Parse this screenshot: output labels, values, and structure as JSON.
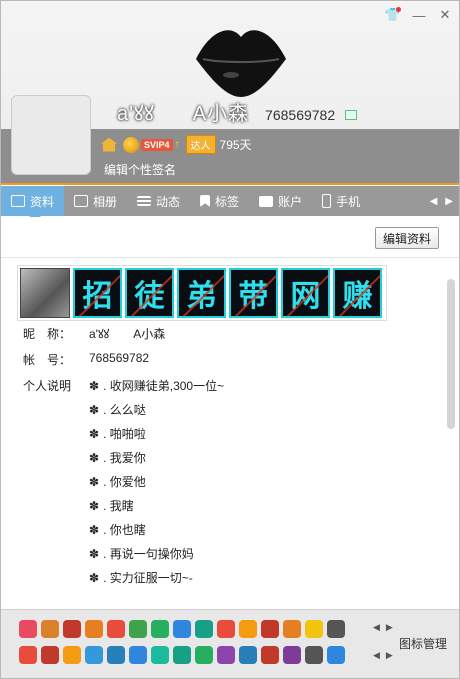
{
  "window": {
    "controls": {
      "skin_icon": "skin-icon",
      "minimize": "—",
      "close": "✕"
    }
  },
  "profile": {
    "nickname_left": "a'ꙋꙋ",
    "nickname_right": "A小森",
    "qq_number": "768569782",
    "svip_level": "SVIP4",
    "svip_arrow": "↑",
    "daren_tag": "达人",
    "daren_days": "795天",
    "signature": "编辑个性签名"
  },
  "tabs": [
    {
      "label": "资料",
      "icon": "profile-card-icon",
      "active": true
    },
    {
      "label": "相册",
      "icon": "photo-album-icon",
      "active": false
    },
    {
      "label": "动态",
      "icon": "feed-list-icon",
      "active": false
    },
    {
      "label": "标签",
      "icon": "tag-bookmark-icon",
      "active": false
    },
    {
      "label": "账户",
      "icon": "wallet-icon",
      "active": false
    },
    {
      "label": "手机",
      "icon": "phone-icon",
      "active": false
    }
  ],
  "tab_nav": {
    "prev": "◀",
    "next": "▶"
  },
  "content": {
    "edit_button": "编辑资料",
    "banner_chars": [
      "招",
      "徒",
      "弟",
      "带",
      "网",
      "赚"
    ],
    "fields": {
      "nickname_label": "昵　称：",
      "nickname_value": "a'ꙋꙋ　　A小森",
      "account_label": "帐　号：",
      "account_value": "768569782",
      "desc_label": "个人说明"
    },
    "description_bullet": "✽",
    "description_lines": [
      ". 收网赚徒弟,300一位~",
      ". 么么哒",
      ". 啪啪啦",
      ". 我爱你",
      ". 你爱他",
      ". 我瞎",
      ". 你也瞎",
      ". 再说一句操你妈",
      ". 实力征服一切~-"
    ]
  },
  "footer": {
    "manage_label": "图标管理",
    "nav_prev": "◀",
    "nav_next": "▶",
    "icons_row1": [
      "#e84a5f",
      "#d9822b",
      "#c0392b",
      "#e67e22",
      "#e74c3c",
      "#3fa34d",
      "#27ae60",
      "#2e86de",
      "#16a085",
      "#e74c3c",
      "#f39c12",
      "#c0392b",
      "#e67e22",
      "#f1c40f",
      "#555555"
    ],
    "icons_row2": [
      "#e74c3c",
      "#c0392b",
      "#f39c12",
      "#3498db",
      "#2980b9",
      "#2e86de",
      "#1abc9c",
      "#16a085",
      "#27ae60",
      "#8e44ad",
      "#2980b9",
      "#c0392b",
      "#7d3c98",
      "#555555",
      "#2e86de"
    ]
  },
  "colors": {
    "tab_active": "#6fb1e0",
    "header_band": "#8e8e8e",
    "accent_line": "#f29b1b",
    "banner_glow": "#1fd0d8"
  }
}
